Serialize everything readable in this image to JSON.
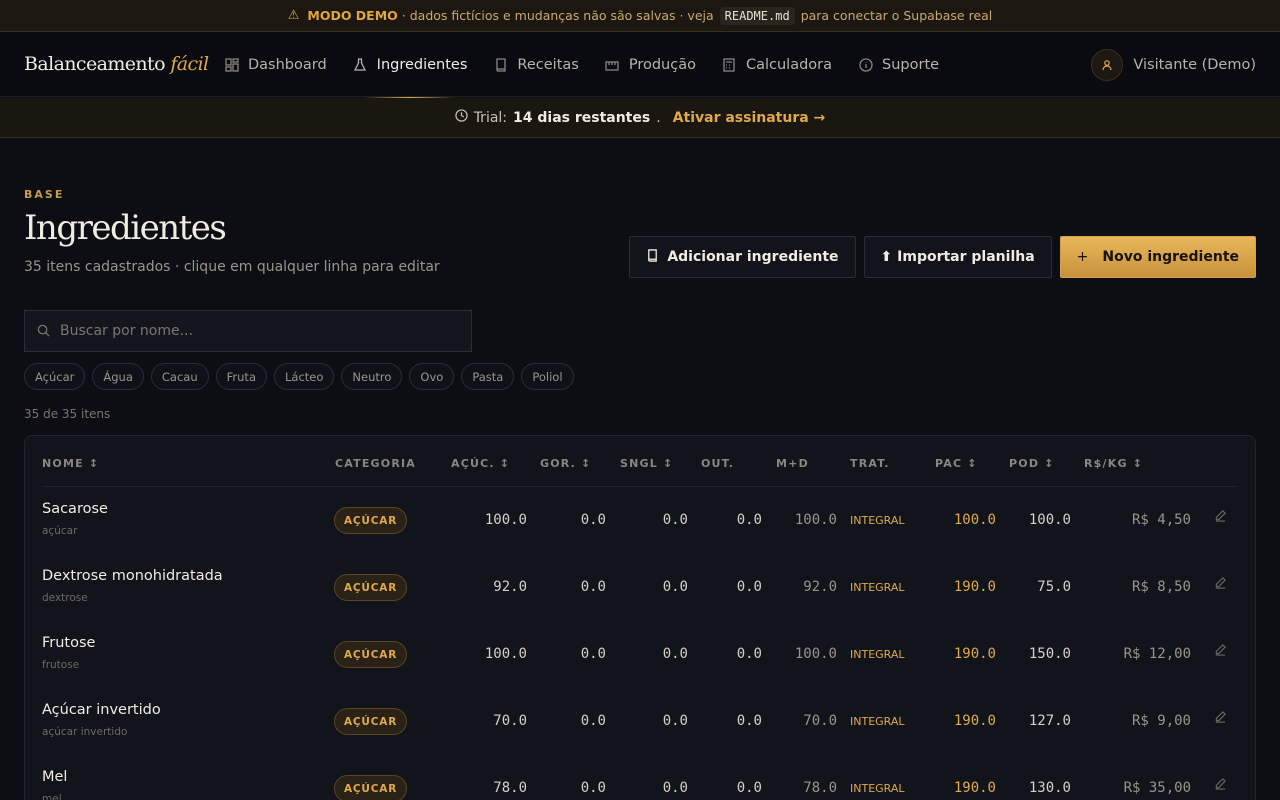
{
  "demo_banner": {
    "label": "MODO DEMO",
    "text": "· dados fictícios e mudanças não são salvas · veja",
    "code": "README.md",
    "tail": "para conectar o Supabase real"
  },
  "nav": {
    "brand_main": "Balanceamento",
    "brand_accent": "fácil",
    "items": [
      {
        "label": "Dashboard",
        "icon": "dashboard-icon"
      },
      {
        "label": "Ingredientes",
        "icon": "flask-icon"
      },
      {
        "label": "Receitas",
        "icon": "book-icon"
      },
      {
        "label": "Produção",
        "icon": "factory-icon"
      },
      {
        "label": "Calculadora",
        "icon": "calculator-icon"
      },
      {
        "label": "Suporte",
        "icon": "info-icon"
      }
    ],
    "active": "Ingredientes",
    "user": "Visitante (Demo)"
  },
  "trial": {
    "prefix": "Trial:",
    "days": "14 dias restantes",
    "cta": "Ativar assinatura →"
  },
  "page": {
    "eyebrow": "BASE",
    "title": "Ingredientes",
    "subtitle": "35 itens cadastrados · clique em qualquer linha para editar"
  },
  "actions": {
    "add": "Adicionar ingrediente",
    "import": "⬆ Importar planilha",
    "new": "Novo ingrediente"
  },
  "search": {
    "placeholder": "Buscar por nome..."
  },
  "filters": [
    "Açúcar",
    "Água",
    "Cacau",
    "Fruta",
    "Lácteo",
    "Neutro",
    "Ovo",
    "Pasta",
    "Poliol"
  ],
  "count": "35 de 35 itens",
  "table": {
    "headers": [
      "NOME ↕",
      "CATEGORIA",
      "AÇÚC. ↕",
      "GOR. ↕",
      "SNGL ↕",
      "OUT.",
      "M+D",
      "TRAT.",
      "PAC ↕",
      "POD ↕",
      "R$/KG ↕"
    ],
    "rows": [
      {
        "name": "Sacarose",
        "alias": "açúcar",
        "category": "AÇÚCAR",
        "acuc": "100.0",
        "gor": "0.0",
        "sngl": "0.0",
        "out": "0.0",
        "md": "100.0",
        "trat": "INTEGRAL",
        "pac": "100.0",
        "pod": "100.0",
        "price": "R$ 4,50"
      },
      {
        "name": "Dextrose monohidratada",
        "alias": "dextrose",
        "category": "AÇÚCAR",
        "acuc": "92.0",
        "gor": "0.0",
        "sngl": "0.0",
        "out": "0.0",
        "md": "92.0",
        "trat": "INTEGRAL",
        "pac": "190.0",
        "pod": "75.0",
        "price": "R$ 8,50"
      },
      {
        "name": "Frutose",
        "alias": "frutose",
        "category": "AÇÚCAR",
        "acuc": "100.0",
        "gor": "0.0",
        "sngl": "0.0",
        "out": "0.0",
        "md": "100.0",
        "trat": "INTEGRAL",
        "pac": "190.0",
        "pod": "150.0",
        "price": "R$ 12,00"
      },
      {
        "name": "Açúcar invertido",
        "alias": "açúcar invertido",
        "category": "AÇÚCAR",
        "acuc": "70.0",
        "gor": "0.0",
        "sngl": "0.0",
        "out": "0.0",
        "md": "70.0",
        "trat": "INTEGRAL",
        "pac": "190.0",
        "pod": "127.0",
        "price": "R$ 9,00"
      },
      {
        "name": "Mel",
        "alias": "mel",
        "category": "AÇÚCAR",
        "acuc": "78.0",
        "gor": "0.0",
        "sngl": "0.0",
        "out": "0.0",
        "md": "78.0",
        "trat": "INTEGRAL",
        "pac": "190.0",
        "pod": "130.0",
        "price": "R$ 35,00"
      }
    ]
  },
  "colors": {
    "accent": "#e0a94a",
    "background": "#0c0e14",
    "card": "#12141b"
  }
}
